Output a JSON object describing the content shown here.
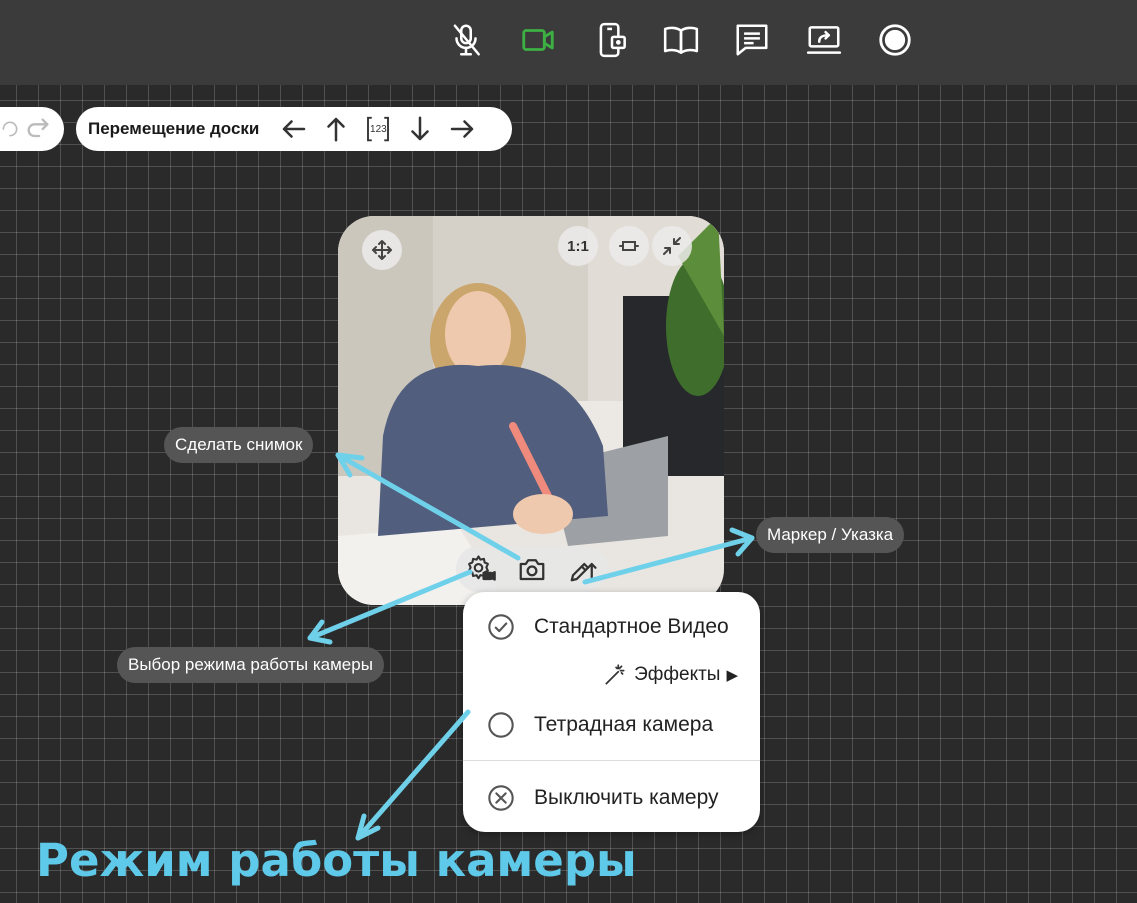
{
  "topbar": {
    "icons": [
      "mic-off-icon",
      "camera-icon",
      "phone-camera-icon",
      "book-icon",
      "chat-icon",
      "screen-share-icon",
      "record-icon"
    ],
    "camera_color": "#3cb043"
  },
  "board_nav": {
    "title": "Перемещение доски",
    "page_label": "123"
  },
  "video": {
    "ratio_label": "1:1"
  },
  "callouts": {
    "snapshot": "Сделать снимок",
    "marker": "Маркер / Указка",
    "mode": "Выбор режима работы камеры"
  },
  "menu": {
    "standard": "Стандартное Видео",
    "effects": "Эффекты",
    "notebook": "Тетрадная камера",
    "off": "Выключить камеру"
  },
  "caption": "Режим работы камеры",
  "colors": {
    "accent": "#5ec9e8",
    "callout_bg": "#555555",
    "topbar": "#3b3b3b",
    "board": "#2a2a2a"
  }
}
